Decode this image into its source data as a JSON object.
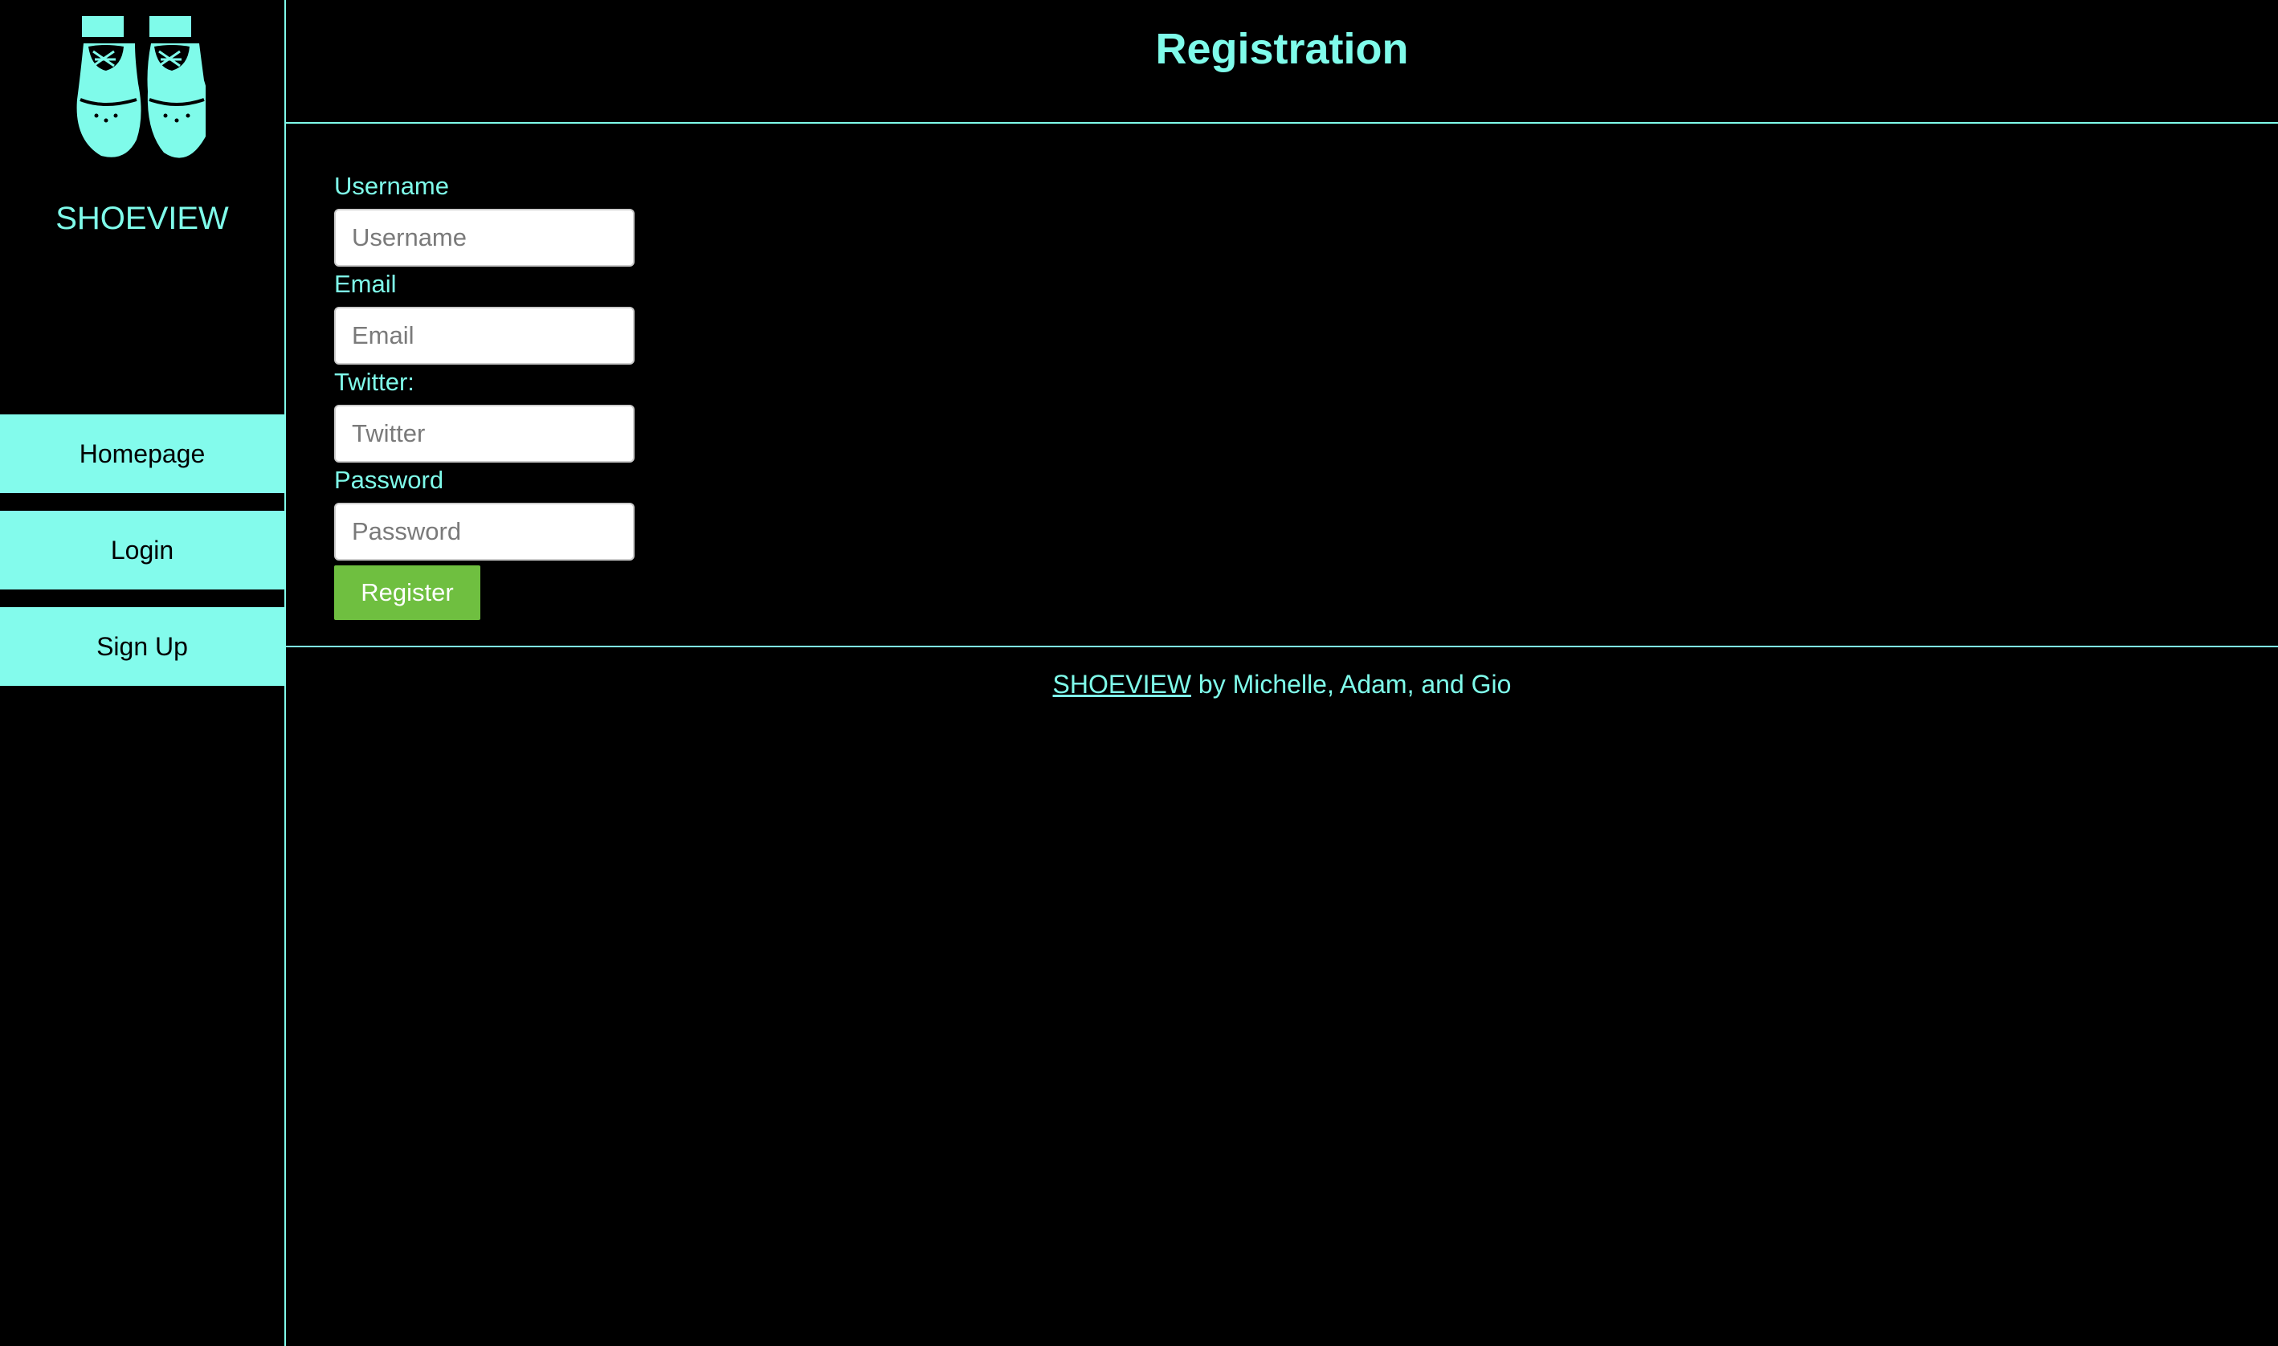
{
  "brand": {
    "name": "SHOEVIEW",
    "logo_icon": "shoes-logo-icon"
  },
  "nav": {
    "items": [
      {
        "label": "Homepage"
      },
      {
        "label": "Login"
      },
      {
        "label": "Sign Up"
      }
    ]
  },
  "page": {
    "title": "Registration"
  },
  "form": {
    "username": {
      "label": "Username",
      "placeholder": "Username"
    },
    "email": {
      "label": "Email",
      "placeholder": "Email"
    },
    "twitter": {
      "label": "Twitter:",
      "placeholder": "Twitter"
    },
    "password": {
      "label": "Password",
      "placeholder": "Password"
    },
    "submit_label": "Register"
  },
  "footer": {
    "link_text": "SHOEVIEW",
    "credits": " by Michelle, Adam, and Gio"
  },
  "colors": {
    "accent": "#7ffbea",
    "nav_bg": "#83fbec",
    "button": "#6fbf40",
    "background": "#000000"
  }
}
